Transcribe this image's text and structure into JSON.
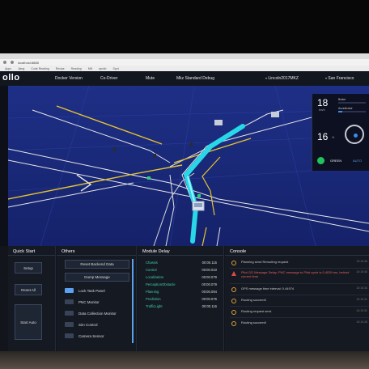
{
  "browser": {
    "url": "localhost:8888",
    "bookmarks": [
      "Apps",
      "Jiang",
      "Code Reading",
      "Recipe",
      "Reading",
      "MN",
      "apollo",
      "Spot"
    ]
  },
  "header": {
    "logo": "ollo",
    "docker_version": "Docker Version",
    "co_driver": "Co-Driver",
    "mute": "Mute",
    "mode": "Mkz Standard Debug",
    "vehicle": "Lincoln2017MKZ",
    "map": "San Francisco"
  },
  "status": {
    "speed": "18",
    "speed_unit": "km/h",
    "brake_label": "Brake",
    "brake_level": 0.0,
    "accel_label": "Accelerator",
    "accel_level": 0.15,
    "steering": "16",
    "steering_unit": "%",
    "traffic_light": "GREEN",
    "drive_mode": "AUTO"
  },
  "quick_start": {
    "title": "Quick Start",
    "buttons": [
      "Setup",
      "Reset All",
      "Start Auto"
    ]
  },
  "others": {
    "title": "Others",
    "buttons": [
      "Reset Backend Data",
      "Dump Message"
    ],
    "toggles": [
      {
        "label": "Lock Task Panel",
        "on": true
      },
      {
        "label": "PNC Monitor",
        "on": false
      },
      {
        "label": "Data Collection Monitor",
        "on": false
      },
      {
        "label": "Sim Control",
        "on": false
      },
      {
        "label": "Camera Sensor",
        "on": false
      }
    ]
  },
  "module_delay": {
    "title": "Module Delay",
    "rows": [
      {
        "name": "Chassis",
        "value": "00:00.115"
      },
      {
        "name": "Control",
        "value": "00:00.010"
      },
      {
        "name": "Localization",
        "value": "00:00.079"
      },
      {
        "name": "PerceptionObstacle",
        "value": "00:00.079"
      },
      {
        "name": "Planning",
        "value": "00:00.094"
      },
      {
        "name": "Prediction",
        "value": "00:00.076"
      },
      {
        "name": "TrafficLight",
        "value": "00:00.116"
      }
    ]
  },
  "console": {
    "title": "Console",
    "messages": [
      {
        "text": "Planning send Rerouting request",
        "level": "info",
        "time": "10:10:46"
      },
      {
        "text": "Pilot GG Message Delay: PNC message to Pilot cycle is 0.4039 ms, behind current time",
        "level": "warn",
        "time": "10:10:40"
      },
      {
        "text": "GPS message time interval: 0.44974",
        "level": "info",
        "time": "10:10:34"
      },
      {
        "text": "Routing succeed!",
        "level": "info",
        "time": "10:10:31"
      },
      {
        "text": "Routing request sent.",
        "level": "info",
        "time": "10:10:31"
      },
      {
        "text": "Routing succeed!",
        "level": "info",
        "time": "10:10:28"
      }
    ]
  },
  "colors": {
    "accent": "#5aa2f0",
    "road_bg": "#1b2a7a",
    "lane_yellow": "#e6c42e",
    "path_cyan": "#28d7e8",
    "light_green": "#22c35e"
  }
}
